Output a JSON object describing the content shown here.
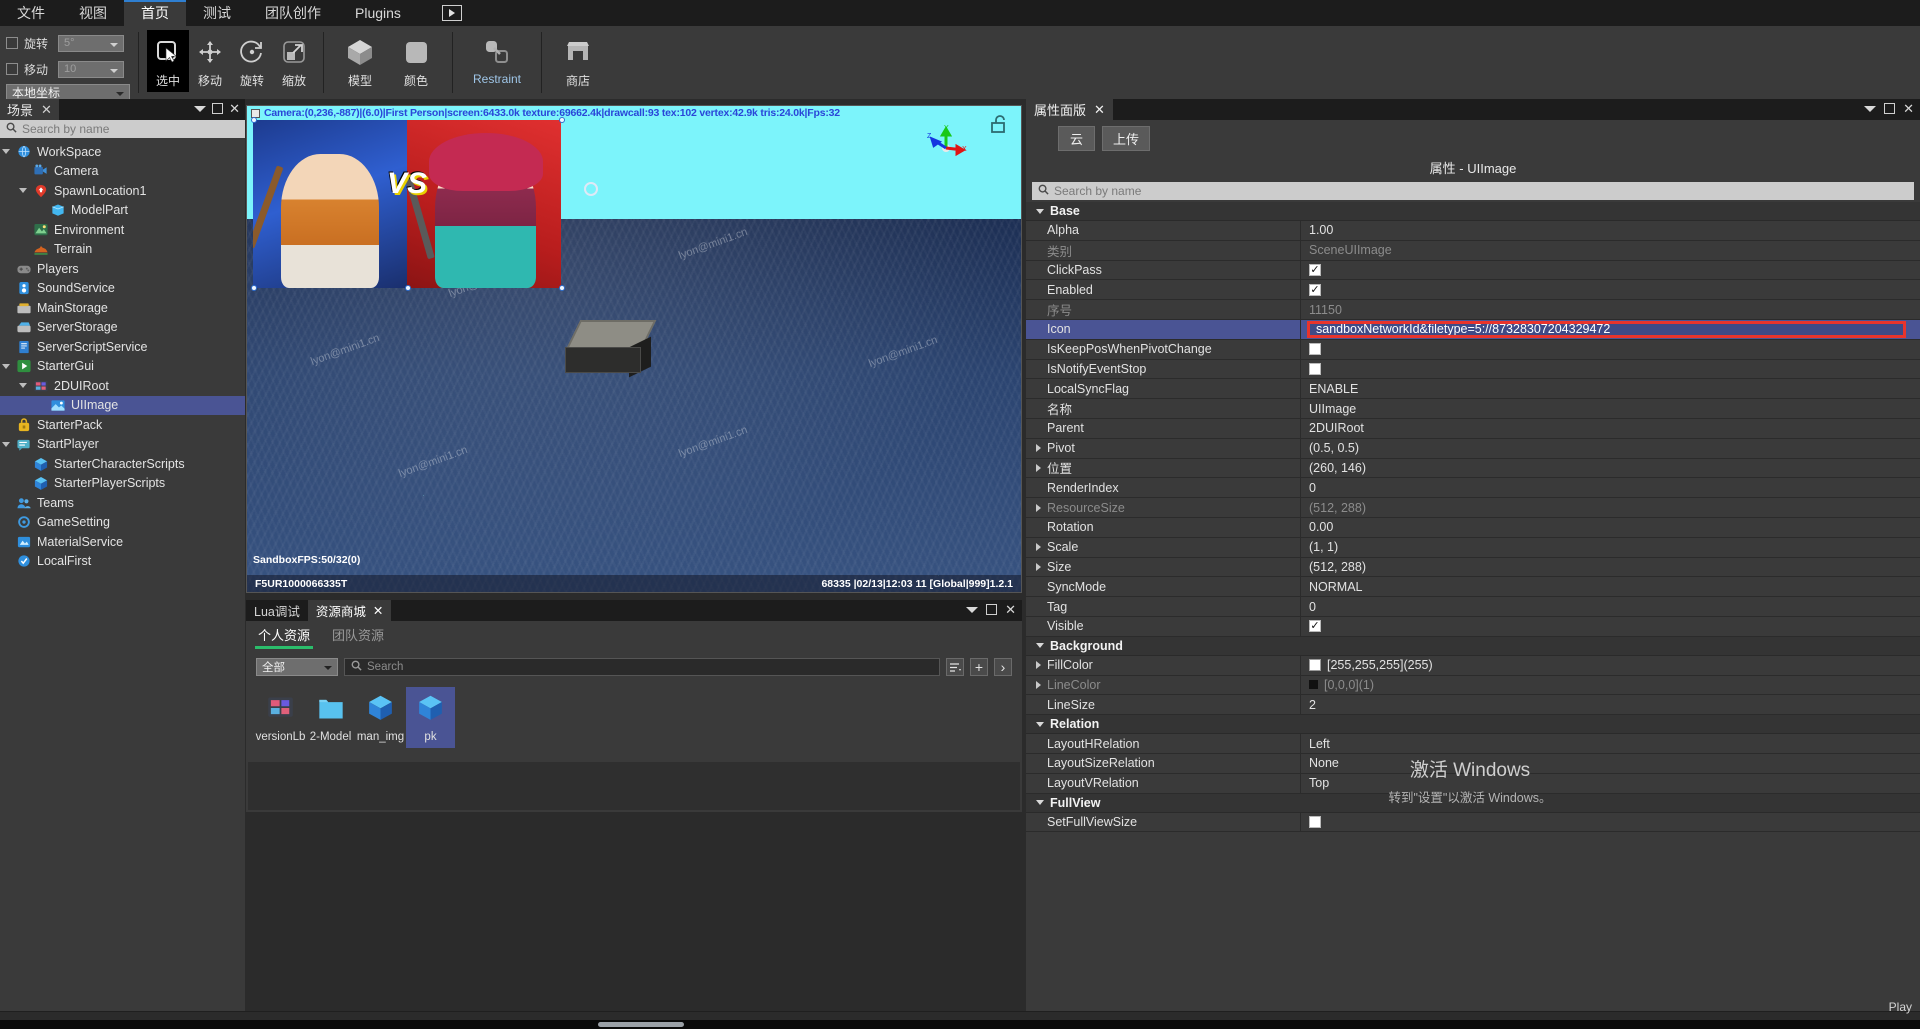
{
  "menubar": {
    "items": [
      {
        "label": "文件",
        "active": false
      },
      {
        "label": "视图",
        "active": false
      },
      {
        "label": "首页",
        "active": true
      },
      {
        "label": "测试",
        "active": false
      },
      {
        "label": "团队创作",
        "active": false
      },
      {
        "label": "Plugins",
        "active": false
      }
    ],
    "play_icon": "play-icon"
  },
  "toolbar": {
    "snap": {
      "rotate_label": "旋转",
      "rotate_value": "5°",
      "move_label": "移动",
      "move_value": "10",
      "coord_value": "本地坐标"
    },
    "tools": [
      {
        "label": "选中",
        "icon": "cursor-select-icon",
        "selected": true
      },
      {
        "label": "移动",
        "icon": "move-arrows-icon",
        "selected": false
      },
      {
        "label": "旋转",
        "icon": "rotate-circle-icon",
        "selected": false
      },
      {
        "label": "缩放",
        "icon": "scale-arrow-icon",
        "selected": false
      }
    ],
    "create": [
      {
        "label": "模型",
        "icon": "cube-icon"
      },
      {
        "label": "颜色",
        "icon": "color-square-icon"
      }
    ],
    "restraint": {
      "label": "Restraint",
      "icon": "constraint-icon"
    },
    "store": {
      "label": "商店",
      "icon": "store-icon"
    }
  },
  "scene_panel": {
    "tab_label": "场景",
    "close_icon": "close-icon",
    "search_placeholder": "Search by name",
    "tree": [
      {
        "label": "WorkSpace",
        "depth": 0,
        "icon": "globe-icon",
        "arrow": "down",
        "selected": false
      },
      {
        "label": "Camera",
        "depth": 1,
        "icon": "camera-icon",
        "arrow": "none",
        "selected": false
      },
      {
        "label": "SpawnLocation1",
        "depth": 1,
        "icon": "spawn-pin-icon",
        "arrow": "down",
        "selected": false
      },
      {
        "label": "ModelPart",
        "depth": 2,
        "icon": "part-icon",
        "arrow": "none",
        "selected": false
      },
      {
        "label": "Environment",
        "depth": 1,
        "icon": "environment-icon",
        "arrow": "none",
        "selected": false
      },
      {
        "label": "Terrain",
        "depth": 1,
        "icon": "terrain-icon",
        "arrow": "none",
        "selected": false
      },
      {
        "label": "Players",
        "depth": 0,
        "icon": "gamepad-icon",
        "arrow": "none",
        "selected": false
      },
      {
        "label": "SoundService",
        "depth": 0,
        "icon": "sound-icon",
        "arrow": "none",
        "selected": false
      },
      {
        "label": "MainStorage",
        "depth": 0,
        "icon": "storage-icon",
        "arrow": "none",
        "selected": false
      },
      {
        "label": "ServerStorage",
        "depth": 0,
        "icon": "server-storage-icon",
        "arrow": "none",
        "selected": false
      },
      {
        "label": "ServerScriptService",
        "depth": 0,
        "icon": "script-icon",
        "arrow": "none",
        "selected": false
      },
      {
        "label": "StarterGui",
        "depth": 0,
        "icon": "starter-gui-icon",
        "arrow": "down",
        "selected": false
      },
      {
        "label": "2DUIRoot",
        "depth": 1,
        "icon": "ui-root-icon",
        "arrow": "down",
        "selected": false
      },
      {
        "label": "UIImage",
        "depth": 2,
        "icon": "image-icon",
        "arrow": "none",
        "selected": true
      },
      {
        "label": "StarterPack",
        "depth": 0,
        "icon": "backpack-icon",
        "arrow": "none",
        "selected": false
      },
      {
        "label": "StartPlayer",
        "depth": 0,
        "icon": "player-icon",
        "arrow": "down",
        "selected": false
      },
      {
        "label": "StarterCharacterScripts",
        "depth": 1,
        "icon": "cube-blue-icon",
        "arrow": "none",
        "selected": false
      },
      {
        "label": "StarterPlayerScripts",
        "depth": 1,
        "icon": "cube-blue-icon",
        "arrow": "none",
        "selected": false
      },
      {
        "label": "Teams",
        "depth": 0,
        "icon": "teams-icon",
        "arrow": "none",
        "selected": false
      },
      {
        "label": "GameSetting",
        "depth": 0,
        "icon": "gamesetting-icon",
        "arrow": "none",
        "selected": false
      },
      {
        "label": "MaterialService",
        "depth": 0,
        "icon": "material-icon",
        "arrow": "none",
        "selected": false
      },
      {
        "label": "LocalFirst",
        "depth": 0,
        "icon": "localfirst-icon",
        "arrow": "none",
        "selected": false
      }
    ]
  },
  "viewport": {
    "stats_line": "Camera:(0,236,-887)|(6.0)|First Person|screen:6433.0k texture:69662.4k|drawcall:93 tex:102 vertex:42.9k tris:24.0k|Fps:32",
    "fps_line": "SandboxFPS:50/32(0)",
    "bottom_left": "F5UR1000066335T",
    "bottom_right": "68335    |02/13|12:03 11  [Global|999]1.2.1",
    "vs_text": "VS",
    "gizmo_axes": [
      "X",
      "Y",
      "Z"
    ],
    "lock_icon": "unlock-icon",
    "watermarks": [
      "lyon@mini1.cn",
      "lyon@mini1.cn",
      "lyon@mini1.cn",
      "lyon@mini1.cn",
      "lyon@mini1.cn",
      "lyon@mini1.cn"
    ]
  },
  "asset_panel": {
    "tabs": [
      {
        "label": "Lua调试",
        "active": false,
        "closable": false
      },
      {
        "label": "资源商城",
        "active": true,
        "closable": true
      }
    ],
    "subtabs": [
      {
        "label": "个人资源",
        "active": true
      },
      {
        "label": "团队资源",
        "active": false
      }
    ],
    "filter_value": "全部",
    "search_placeholder": "Search",
    "buttons": {
      "list_icon": "list-view-icon",
      "add_icon": "plus-icon",
      "next_icon": "chevron-right-icon"
    },
    "items": [
      {
        "name": "versionLb",
        "icon": "ui-root-icon",
        "selected": false
      },
      {
        "name": "2-Model",
        "icon": "folder-icon",
        "selected": false
      },
      {
        "name": "man_img",
        "icon": "cube-blue-icon",
        "selected": false
      },
      {
        "name": "pk",
        "icon": "cube-blue-icon",
        "selected": true
      }
    ]
  },
  "props_panel": {
    "tab_label": "属性面版",
    "close_icon": "close-icon",
    "buttons": [
      {
        "label": "云"
      },
      {
        "label": "上传"
      }
    ],
    "title": "属性 - UIImage",
    "search_placeholder": "Search by name",
    "collapse_icon": "chevron-down-icon",
    "groups": [
      {
        "name": "Base",
        "rows": [
          {
            "name": "Alpha",
            "value": "1.00",
            "type": "text",
            "dim": false,
            "expandable": false,
            "selected": false
          },
          {
            "name": "类别",
            "value": "SceneUIImage",
            "type": "text",
            "dim": true,
            "expandable": false,
            "selected": false
          },
          {
            "name": "ClickPass",
            "value": "checked",
            "type": "checkbox",
            "dim": false,
            "expandable": false,
            "selected": false
          },
          {
            "name": "Enabled",
            "value": "checked",
            "type": "checkbox",
            "dim": false,
            "expandable": false,
            "selected": false
          },
          {
            "name": "序号",
            "value": "11150",
            "type": "text",
            "dim": true,
            "expandable": false,
            "selected": false
          },
          {
            "name": "Icon",
            "value": "sandboxNetworkId&filetype=5://87328307204329472",
            "type": "highlighted-input",
            "dim": false,
            "expandable": false,
            "selected": true
          },
          {
            "name": "IsKeepPosWhenPivotChange",
            "value": "unchecked",
            "type": "checkbox",
            "dim": false,
            "expandable": false,
            "selected": false
          },
          {
            "name": "IsNotifyEventStop",
            "value": "unchecked",
            "type": "checkbox",
            "dim": false,
            "expandable": false,
            "selected": false
          },
          {
            "name": "LocalSyncFlag",
            "value": "ENABLE",
            "type": "text",
            "dim": false,
            "expandable": false,
            "selected": false
          },
          {
            "name": "名称",
            "value": "UIImage",
            "type": "text",
            "dim": false,
            "expandable": false,
            "selected": false
          },
          {
            "name": "Parent",
            "value": "2DUIRoot",
            "type": "text",
            "dim": false,
            "expandable": false,
            "selected": false
          },
          {
            "name": "Pivot",
            "value": "(0.5, 0.5)",
            "type": "text",
            "dim": false,
            "expandable": true,
            "selected": false
          },
          {
            "name": "位置",
            "value": "(260, 146)",
            "type": "text",
            "dim": false,
            "expandable": true,
            "selected": false
          },
          {
            "name": "RenderIndex",
            "value": "0",
            "type": "text",
            "dim": false,
            "expandable": false,
            "selected": false
          },
          {
            "name": "ResourceSize",
            "value": "(512, 288)",
            "type": "text",
            "dim": true,
            "expandable": true,
            "selected": false
          },
          {
            "name": "Rotation",
            "value": "0.00",
            "type": "text",
            "dim": false,
            "expandable": false,
            "selected": false
          },
          {
            "name": "Scale",
            "value": "(1, 1)",
            "type": "text",
            "dim": false,
            "expandable": true,
            "selected": false
          },
          {
            "name": "Size",
            "value": "(512, 288)",
            "type": "text",
            "dim": false,
            "expandable": true,
            "selected": false
          },
          {
            "name": "SyncMode",
            "value": "NORMAL",
            "type": "text",
            "dim": false,
            "expandable": false,
            "selected": false
          },
          {
            "name": "Tag",
            "value": "0",
            "type": "text",
            "dim": false,
            "expandable": false,
            "selected": false
          },
          {
            "name": "Visible",
            "value": "checked",
            "type": "checkbox",
            "dim": false,
            "expandable": false,
            "selected": false
          }
        ]
      },
      {
        "name": "Background",
        "rows": [
          {
            "name": "FillColor",
            "value": "[255,255,255](255)",
            "type": "color",
            "swatch": "#ffffff",
            "dim": false,
            "expandable": true,
            "selected": false
          },
          {
            "name": "LineColor",
            "value": "[0,0,0](1)",
            "type": "color",
            "swatch": "#111111",
            "dim": true,
            "expandable": true,
            "selected": false
          },
          {
            "name": "LineSize",
            "value": "2",
            "type": "text",
            "dim": false,
            "expandable": false,
            "selected": false
          }
        ]
      },
      {
        "name": "Relation",
        "rows": [
          {
            "name": "LayoutHRelation",
            "value": "Left",
            "type": "text",
            "dim": false,
            "expandable": false,
            "selected": false
          },
          {
            "name": "LayoutSizeRelation",
            "value": "None",
            "type": "text",
            "dim": false,
            "expandable": false,
            "selected": false
          },
          {
            "name": "LayoutVRelation",
            "value": "Top",
            "type": "text",
            "dim": false,
            "expandable": false,
            "selected": false
          }
        ]
      },
      {
        "name": "FullView",
        "rows": [
          {
            "name": "SetFullViewSize",
            "value": "unchecked",
            "type": "checkbox",
            "dim": false,
            "expandable": false,
            "selected": false
          }
        ]
      }
    ]
  },
  "windows_activation": {
    "title": "激活 Windows",
    "subtitle": "转到\"设置\"以激活 Windows。"
  },
  "statusbar": {
    "play_label": "Play"
  },
  "colors": {
    "accent_blue": "#4a5494",
    "highlight_red": "#e8342c",
    "panel_bg": "#3a3a3a",
    "menu_bg": "#1c1c1c",
    "tab_underline_green": "#2bbd6b"
  }
}
